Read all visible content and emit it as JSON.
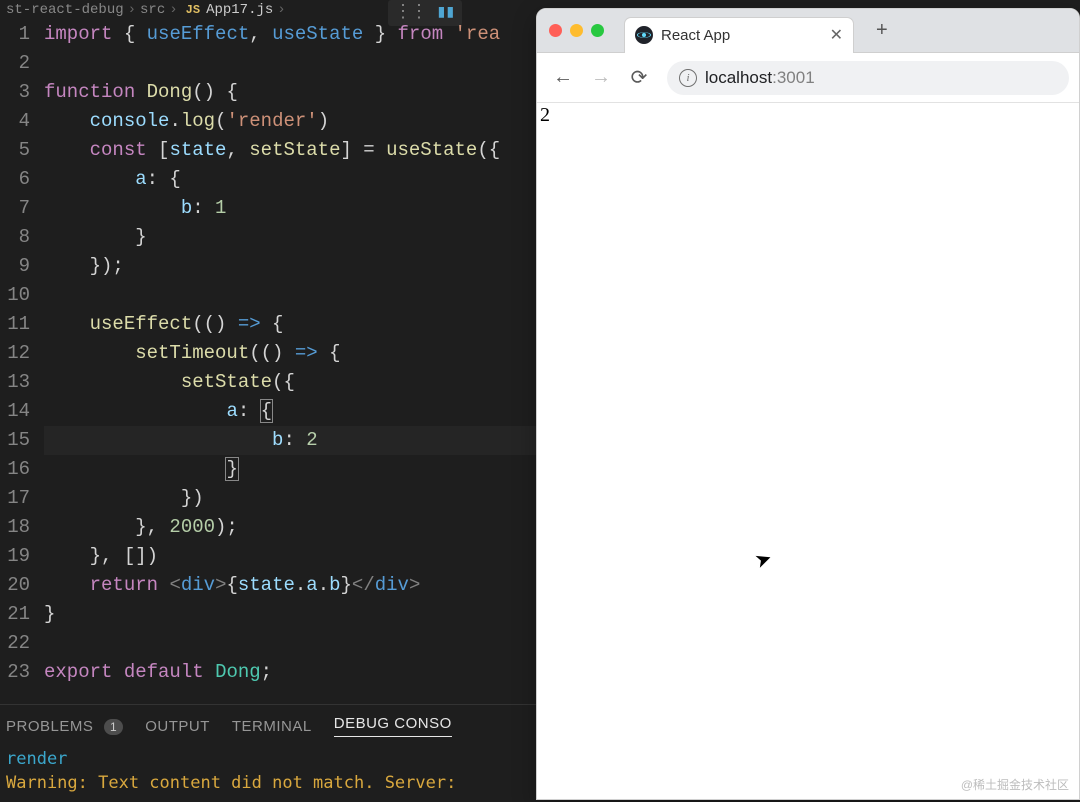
{
  "editor": {
    "breadcrumb": {
      "folder": "st-react-debug",
      "src": "src",
      "file": "App17.js"
    },
    "highlighted_line_index": 14,
    "code_lines": [
      [
        [
          "kw",
          "import"
        ],
        [
          "pn",
          " { "
        ],
        [
          "id",
          "useEffect"
        ],
        [
          "pn",
          ", "
        ],
        [
          "id",
          "useState"
        ],
        [
          "pn",
          " } "
        ],
        [
          "kw",
          "from"
        ],
        [
          "pn",
          " "
        ],
        [
          "str",
          "'rea"
        ],
        [
          "pn",
          ""
        ]
      ],
      [],
      [
        [
          "kw",
          "function"
        ],
        [
          "pn",
          " "
        ],
        [
          "fn",
          "Dong"
        ],
        [
          "pn",
          "() {"
        ]
      ],
      [
        [
          "pn",
          "    "
        ],
        [
          "prop",
          "console"
        ],
        [
          "pn",
          "."
        ],
        [
          "fn",
          "log"
        ],
        [
          "pn",
          "("
        ],
        [
          "str",
          "'render'"
        ],
        [
          "pn",
          ")"
        ]
      ],
      [
        [
          "pn",
          "    "
        ],
        [
          "kw",
          "const"
        ],
        [
          "pn",
          " ["
        ],
        [
          "prop",
          "state"
        ],
        [
          "pn",
          ", "
        ],
        [
          "fn",
          "setState"
        ],
        [
          "pn",
          "] = "
        ],
        [
          "fn",
          "useState"
        ],
        [
          "pn",
          "({"
        ]
      ],
      [
        [
          "pn",
          "        "
        ],
        [
          "prop",
          "a"
        ],
        [
          "pn",
          ": {"
        ]
      ],
      [
        [
          "pn",
          "            "
        ],
        [
          "prop",
          "b"
        ],
        [
          "pn",
          ": "
        ],
        [
          "num",
          "1"
        ]
      ],
      [
        [
          "pn",
          "        }"
        ]
      ],
      [
        [
          "pn",
          "    });"
        ]
      ],
      [],
      [
        [
          "pn",
          "    "
        ],
        [
          "fn",
          "useEffect"
        ],
        [
          "pn",
          "(() "
        ],
        [
          "arrow",
          "=>"
        ],
        [
          "pn",
          " {"
        ]
      ],
      [
        [
          "pn",
          "        "
        ],
        [
          "fn",
          "setTimeout"
        ],
        [
          "pn",
          "(() "
        ],
        [
          "arrow",
          "=>"
        ],
        [
          "pn",
          " {"
        ]
      ],
      [
        [
          "pn",
          "            "
        ],
        [
          "fn",
          "setState"
        ],
        [
          "pn",
          "({"
        ]
      ],
      [
        [
          "pn",
          "                "
        ],
        [
          "prop",
          "a"
        ],
        [
          "pn",
          ": "
        ],
        [
          "brace-box pn",
          "{"
        ]
      ],
      [
        [
          "pn",
          "                    "
        ],
        [
          "prop",
          "b"
        ],
        [
          "pn",
          ": "
        ],
        [
          "num",
          "2"
        ]
      ],
      [
        [
          "pn",
          "                "
        ],
        [
          "brace-box pn",
          "}"
        ]
      ],
      [
        [
          "pn",
          "            })"
        ]
      ],
      [
        [
          "pn",
          "        }, "
        ],
        [
          "num",
          "2000"
        ],
        [
          "pn",
          ");"
        ]
      ],
      [
        [
          "pn",
          "    }, [])"
        ]
      ],
      [
        [
          "pn",
          "    "
        ],
        [
          "kw",
          "return"
        ],
        [
          "pn",
          " "
        ],
        [
          "tag",
          "<"
        ],
        [
          "tagname",
          "div"
        ],
        [
          "tag",
          ">"
        ],
        [
          "pn",
          "{"
        ],
        [
          "prop",
          "state"
        ],
        [
          "pn",
          "."
        ],
        [
          "prop",
          "a"
        ],
        [
          "pn",
          "."
        ],
        [
          "prop",
          "b"
        ],
        [
          "pn",
          "}"
        ],
        [
          "tag",
          "</"
        ],
        [
          "tagname",
          "div"
        ],
        [
          "tag",
          ">"
        ]
      ],
      [
        [
          "pn",
          "}"
        ]
      ],
      [],
      [
        [
          "kw",
          "export"
        ],
        [
          "pn",
          " "
        ],
        [
          "kw",
          "default"
        ],
        [
          "pn",
          " "
        ],
        [
          "cls",
          "Dong"
        ],
        [
          "pn",
          ";"
        ]
      ]
    ]
  },
  "panel": {
    "tabs": {
      "problems": "PROBLEMS",
      "problems_badge": "1",
      "output": "OUTPUT",
      "terminal": "TERMINAL",
      "debug_console": "DEBUG CONSO"
    },
    "lines": [
      {
        "cls": "co-info",
        "text": "render"
      },
      {
        "cls": "co-warn",
        "text": "Warning: Text content did not match. Server:"
      }
    ]
  },
  "browser": {
    "tab_title": "React App",
    "url_host": "localhost",
    "url_port": ":3001",
    "page_output": "2"
  },
  "watermark": "@稀土掘金技术社区"
}
